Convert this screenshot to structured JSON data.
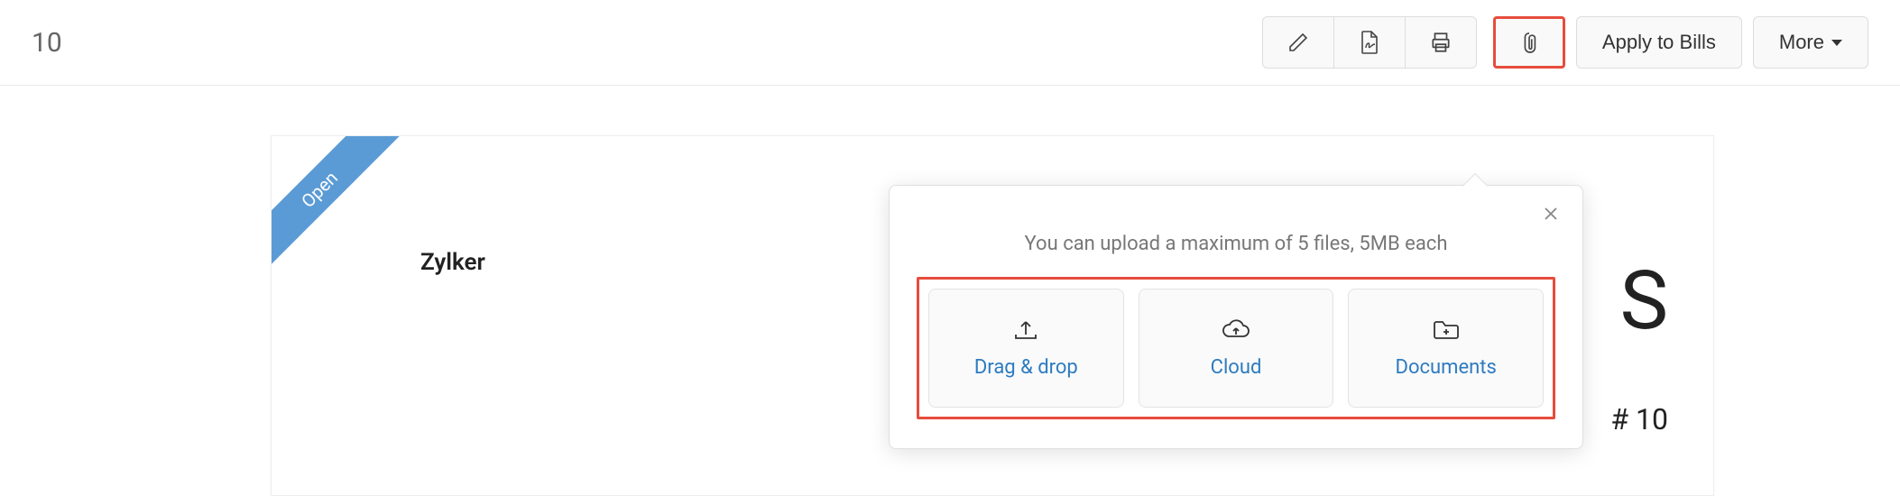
{
  "header": {
    "page_number": "10",
    "apply_button": "Apply to Bills",
    "more_button": "More"
  },
  "document": {
    "status": "Open",
    "vendor": "Zylker",
    "right_letter": "S",
    "right_number_prefix": "#",
    "right_number": "10"
  },
  "popover": {
    "help_text": "You can upload a maximum of 5 files, 5MB each",
    "options": {
      "drag_drop": "Drag & drop",
      "cloud": "Cloud",
      "documents": "Documents"
    }
  }
}
